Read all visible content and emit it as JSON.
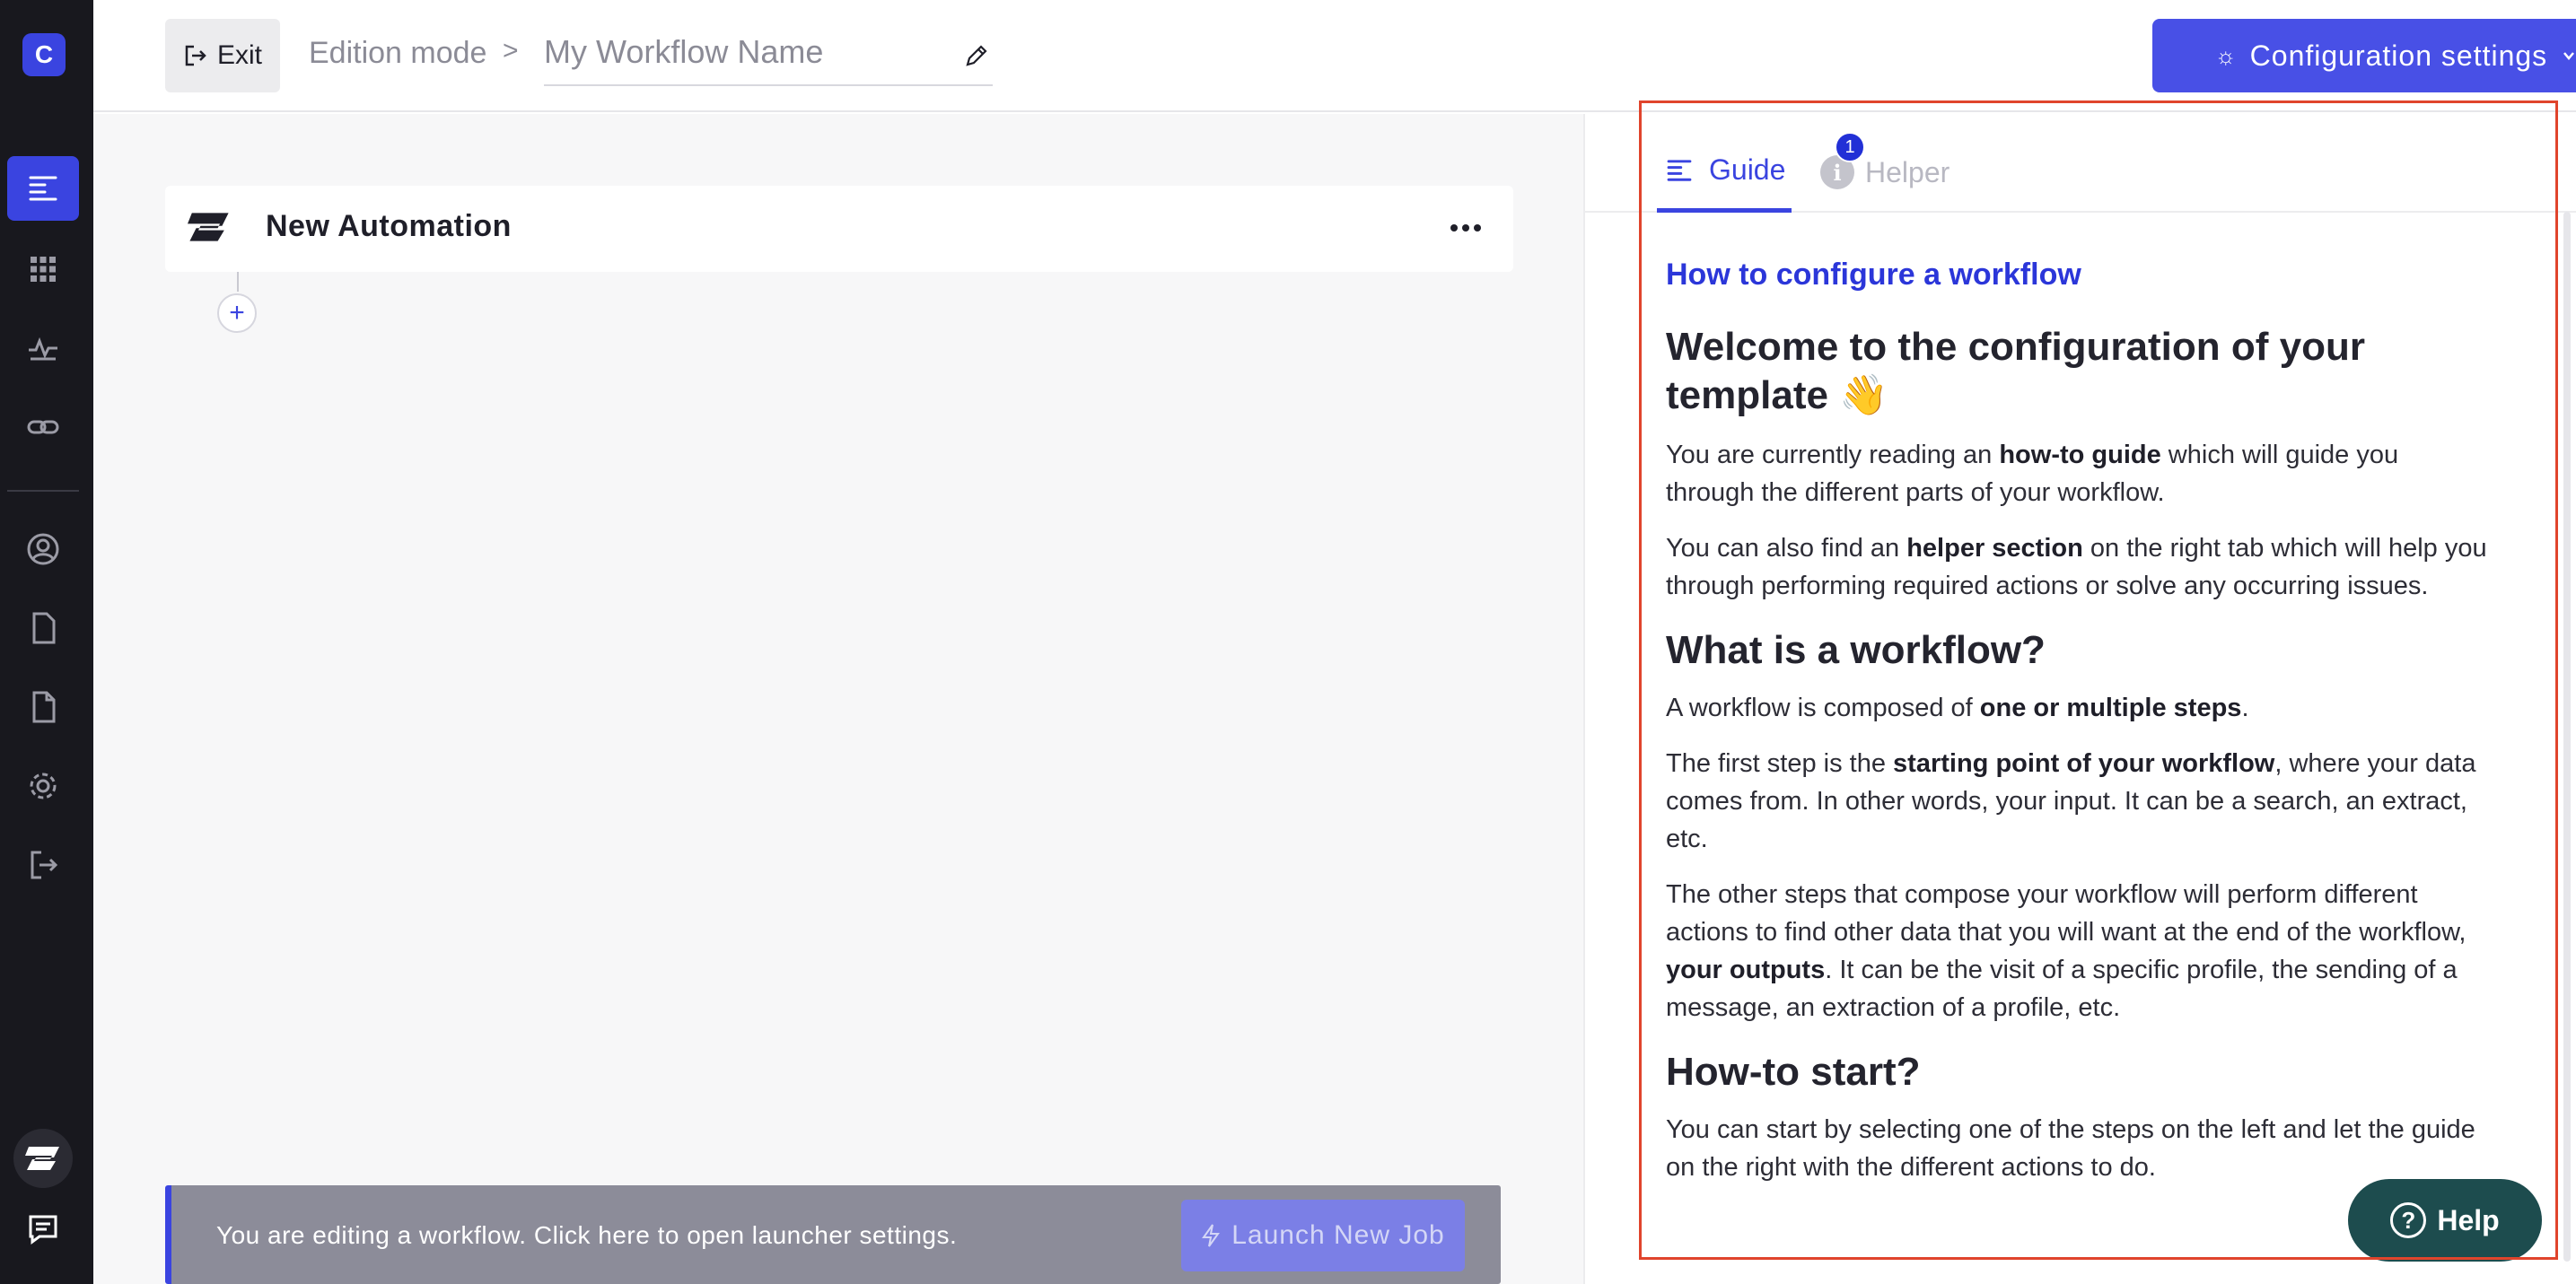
{
  "sidebar": {
    "logo_letter": "C",
    "items": [
      {
        "icon": "guide-icon",
        "active": true
      },
      {
        "icon": "grid-icon",
        "active": false
      },
      {
        "icon": "activity-icon",
        "active": false
      },
      {
        "icon": "link-icon",
        "active": false
      },
      {
        "icon": "user-icon",
        "active": false
      },
      {
        "icon": "document-icon",
        "active": false
      },
      {
        "icon": "file-icon",
        "active": false
      },
      {
        "icon": "gear-icon",
        "active": false
      },
      {
        "icon": "logout-icon",
        "active": false
      }
    ],
    "bottom": [
      "automation-logo-icon",
      "chat-icon"
    ]
  },
  "header": {
    "exit_label": "Exit",
    "breadcrumb": "Edition mode",
    "breadcrumb_sep": ">",
    "workflow_name_placeholder": "My Workflow Name",
    "config_label": "Configuration settings"
  },
  "canvas": {
    "automation_title": "New Automation",
    "add_step_label": "+",
    "launcher_text": "You are editing a workflow. Click here to open launcher settings.",
    "launch_button": "Launch New Job"
  },
  "panel": {
    "tabs": [
      {
        "label": "Guide",
        "active": true
      },
      {
        "label": "Helper",
        "active": false,
        "badge": "1",
        "icon_text": "i"
      }
    ],
    "guide": {
      "kicker": "How to configure a workflow",
      "title": "Welcome to the configuration of your template 👋",
      "intro_1_a": "You are currently reading an ",
      "intro_1_b": "how-to guide",
      "intro_1_c": " which will guide you through the different parts of your workflow.",
      "intro_2_a": "You can also find an ",
      "intro_2_b": "helper section",
      "intro_2_c": " on the right tab which will help you through performing required actions or solve any occurring issues.",
      "h_what": "What is a workflow?",
      "what_1_a": "A workflow is composed of ",
      "what_1_b": "one or multiple steps",
      "what_1_c": ".",
      "what_2_a": "The first step is the ",
      "what_2_b": "starting point of your workflow",
      "what_2_c": ", where your data comes from. In other words, your input. It can be a search, an extract, etc.",
      "what_3_a": "The other steps that compose your workflow will perform different actions to find other data that you will want at the end of the workflow, ",
      "what_3_b": "your outputs",
      "what_3_c": ". It can be the visit of a specific profile, the sending of a message, an extraction of a profile, etc.",
      "h_start": "How-to start?",
      "start_1": "You can start by selecting one of the steps on the left and let the guide on the right with the different actions to do."
    }
  },
  "help": {
    "label": "Help",
    "icon_text": "?"
  },
  "colors": {
    "accent": "#3a44e0",
    "sidebar": "#18181e",
    "highlight": "#e0442c",
    "help": "#1d4c4e"
  }
}
